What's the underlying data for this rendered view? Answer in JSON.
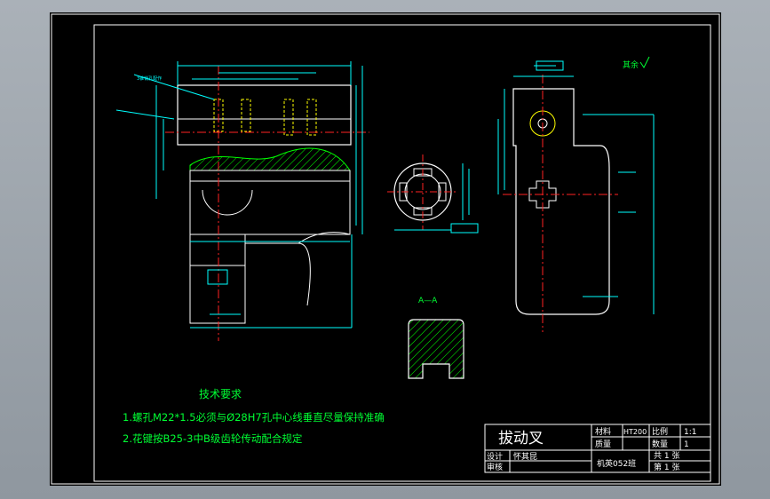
{
  "drawing": {
    "tech_requirements": {
      "title": "技术要求",
      "items": [
        "1.螺孔M22*1.5必须与Ø28H7孔中心线垂直尽量保持准确",
        "2.花键按B25-3中B级齿轮传动配合规定"
      ]
    },
    "section_label": "A—A",
    "roughness_note": "其余",
    "left_note": "3锥销孔配作",
    "title_block": {
      "part_name": "拔动叉",
      "material_label": "材料",
      "material_value": "HT200",
      "scale_label": "比例",
      "scale_value": "1:1",
      "mass_label": "质量",
      "quantity_label": "数量",
      "quantity_value": "1",
      "design_label": "设计",
      "designer": "怀其昆",
      "review_label": "审核",
      "class": "机英052班",
      "total_sheets": "共 1 张",
      "sheet_no": "第 1 张"
    }
  },
  "colors": {
    "background": "#000000",
    "outline": "#ffffff",
    "dimension": "#00ffff",
    "hatch": "#00ff00",
    "centerline": "#ff2222",
    "hidden": "#ffff00",
    "text_req": "#00ff33"
  }
}
